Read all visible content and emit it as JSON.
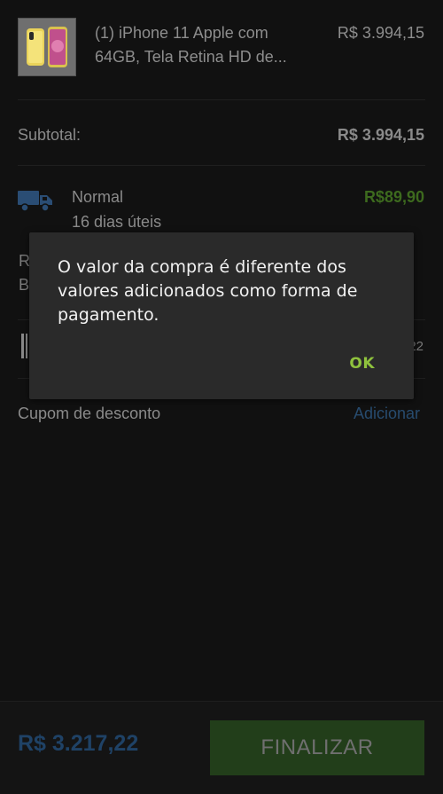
{
  "cart": {
    "product": {
      "name_line1": "(1) iPhone 11 Apple com",
      "name_line2": "64GB, Tela Retina HD de...",
      "price": "R$ 3.994,15",
      "image_icon": "iphone-yellow-image"
    },
    "subtotal": {
      "label": "Subtotal:",
      "value": "R$ 3.994,15"
    },
    "shipping": {
      "icon": "truck-icon",
      "name": "Normal",
      "eta": "16 dias úteis",
      "price": "R$89,90"
    },
    "partially_hidden": {
      "letter_r": "R",
      "letter_b": "B",
      "number_tail": "22"
    },
    "coupon": {
      "label": "Cupom de desconto",
      "action": "Adicionar"
    },
    "footer": {
      "total": "R$ 3.217,22",
      "finalize_label": "FINALIZAR"
    }
  },
  "dialog": {
    "message": "O valor da compra é diferente dos valores adicionados como forma de pagamento.",
    "ok_label": "OK"
  },
  "colors": {
    "background": "#111111",
    "dialog_background": "#2a2a2a",
    "accent_green": "#8fc23d",
    "total_blue": "#1f4266",
    "finalize_button": "#223e1a"
  }
}
